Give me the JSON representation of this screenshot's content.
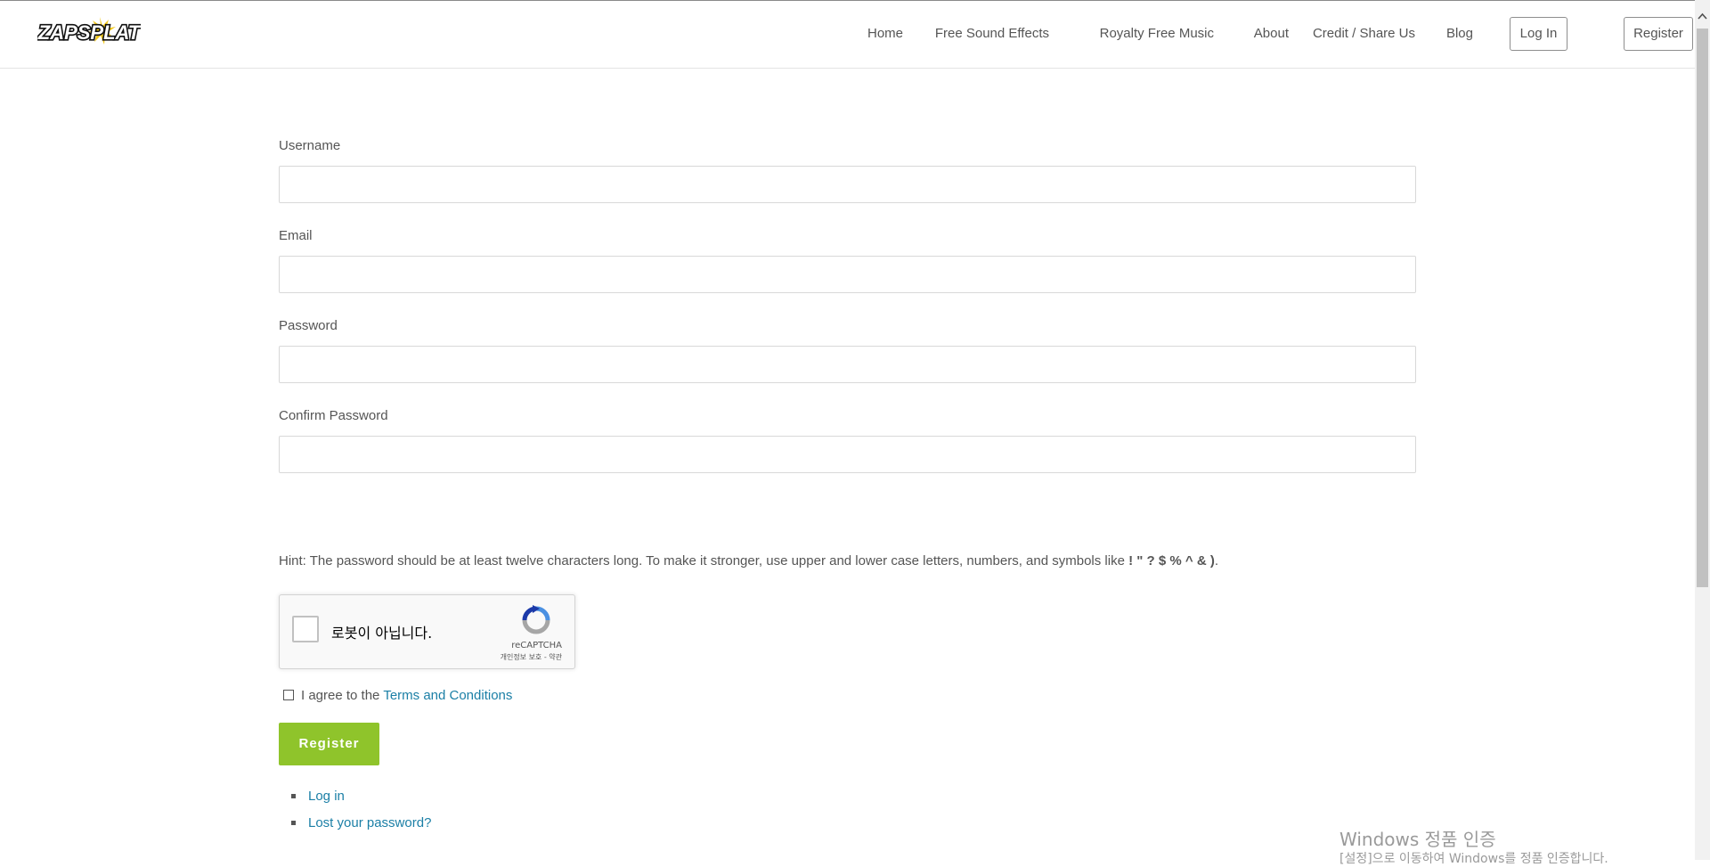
{
  "header": {
    "logo_text": "ZAPSPLAT",
    "nav": {
      "home": "Home",
      "free_sound_effects": "Free Sound Effects",
      "royalty_free_music": "Royalty Free Music",
      "about": "About",
      "credit_share": "Credit / Share Us",
      "blog": "Blog",
      "login": "Log In",
      "register": "Register"
    }
  },
  "form": {
    "username_label": "Username",
    "email_label": "Email",
    "password_label": "Password",
    "confirm_password_label": "Confirm Password",
    "username_value": "",
    "email_value": "",
    "password_value": "",
    "confirm_password_value": ""
  },
  "hint": {
    "prefix": "Hint: The password should be at least twelve characters long. To make it stronger, use upper and lower case letters, numbers, and symbols like ",
    "symbols": "! \" ? $ % ^ & )",
    "suffix": "."
  },
  "recaptcha": {
    "label": "로봇이 아닙니다.",
    "brand": "reCAPTCHA",
    "links": "개인정보 보호 - 약관",
    "checked": false
  },
  "agree": {
    "text": "I agree to the",
    "link": "Terms and Conditions",
    "checked": false
  },
  "register_button": "Register",
  "links": {
    "login": "Log in",
    "lost_password": "Lost your password?"
  },
  "windows_watermark": {
    "title": "Windows 정품 인증",
    "subtitle": "[설정]으로 이동하여 Windows를 정품 인증합니다."
  },
  "colors": {
    "accent_green": "#8fc42b",
    "link_blue": "#1b7fa6",
    "text_gray": "#555555"
  }
}
